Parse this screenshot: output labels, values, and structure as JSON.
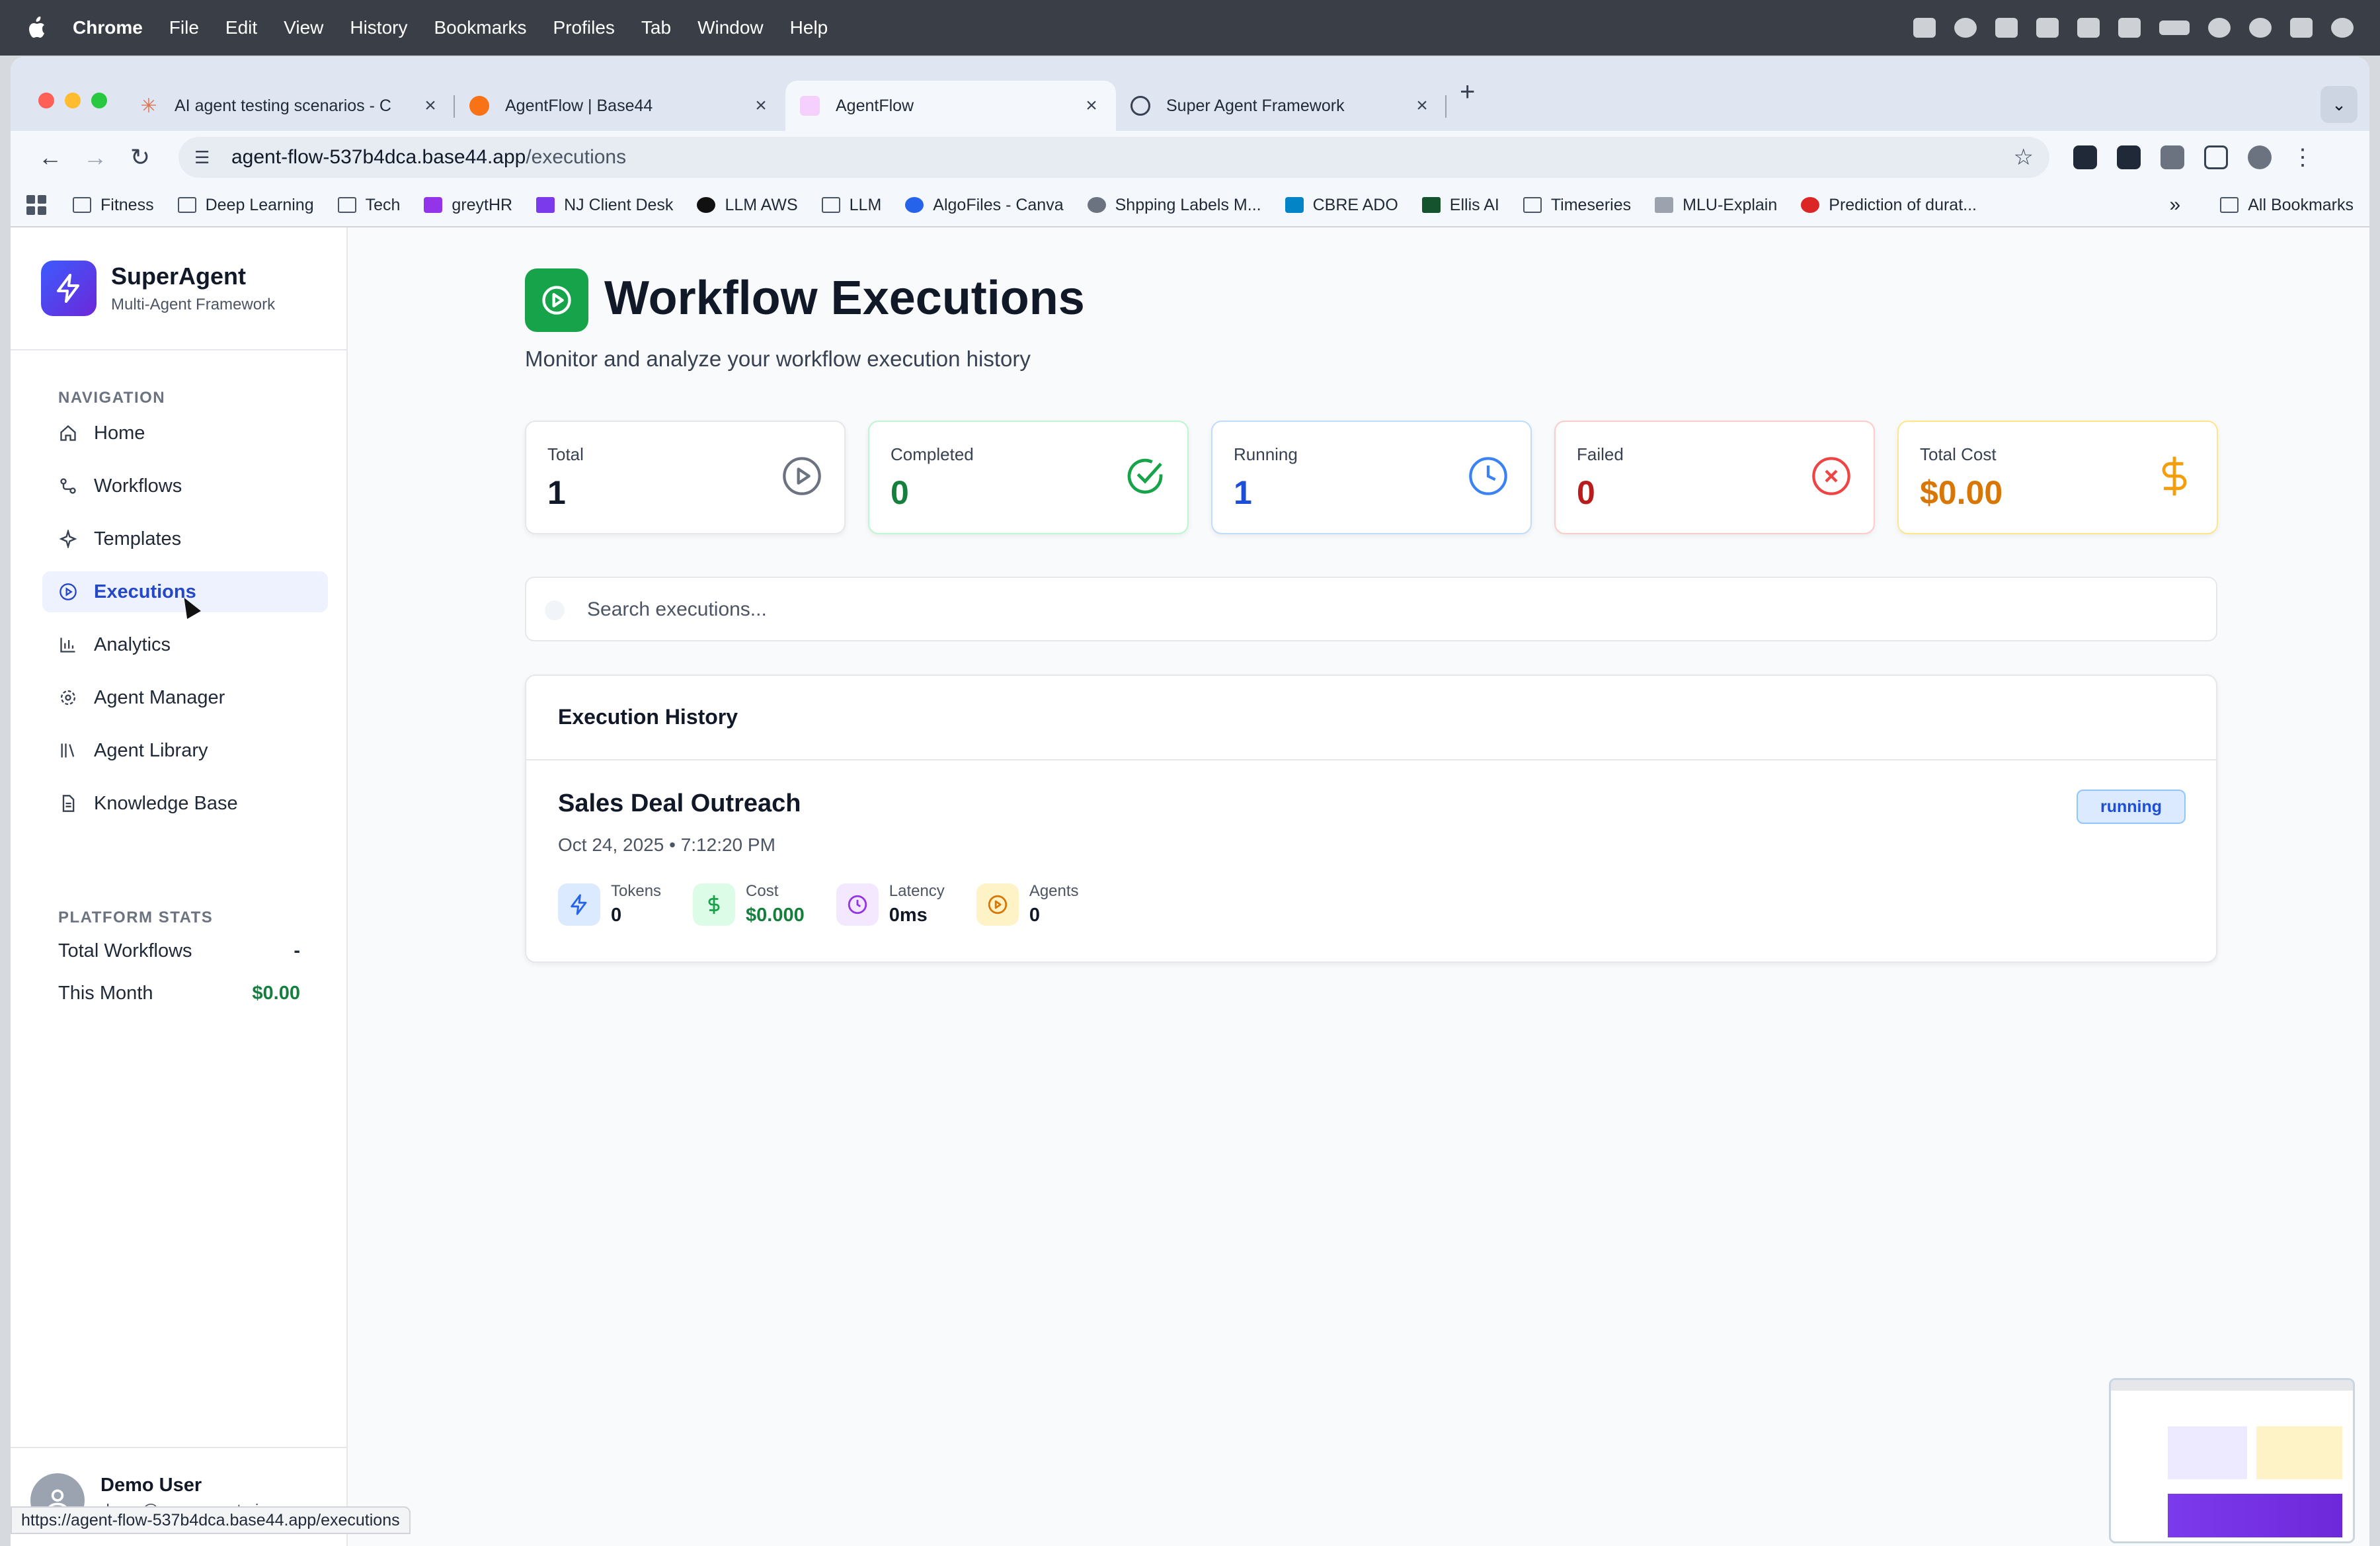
{
  "menubar": {
    "app": "Chrome",
    "items": [
      "File",
      "Edit",
      "View",
      "History",
      "Bookmarks",
      "Profiles",
      "Tab",
      "Window",
      "Help"
    ]
  },
  "browser": {
    "tabs": [
      {
        "title": "AI agent testing scenarios - C",
        "favicon": "claude-icon",
        "active": false
      },
      {
        "title": "AgentFlow | Base44",
        "favicon": "base44-icon",
        "active": false
      },
      {
        "title": "AgentFlow",
        "favicon": "agentflow-icon",
        "active": true
      },
      {
        "title": "Super Agent Framework",
        "favicon": "globe-icon",
        "active": false
      }
    ],
    "url_host": "agent-flow-537b4dca.base44.app",
    "url_path": "/executions",
    "bookmarks": [
      "Fitness",
      "Deep Learning",
      "Tech",
      "greytHR",
      "NJ Client Desk",
      "LLM AWS",
      "LLM",
      "AlgoFiles - Canva",
      "Shpping Labels M...",
      "CBRE ADO",
      "Ellis AI",
      "Timeseries",
      "MLU-Explain",
      "Prediction of durat..."
    ],
    "all_bookmarks": "All Bookmarks",
    "more_bookmarks": "»",
    "status_url": "https://agent-flow-537b4dca.base44.app/executions"
  },
  "sidebar": {
    "brand_name": "SuperAgent",
    "brand_sub": "Multi-Agent Framework",
    "nav_title": "NAVIGATION",
    "items": [
      {
        "label": "Home",
        "icon": "home-icon"
      },
      {
        "label": "Workflows",
        "icon": "workflow-icon"
      },
      {
        "label": "Templates",
        "icon": "sparkle-icon"
      },
      {
        "label": "Executions",
        "icon": "play-circle-icon",
        "active": true
      },
      {
        "label": "Analytics",
        "icon": "bar-chart-icon"
      },
      {
        "label": "Agent Manager",
        "icon": "gear-icon"
      },
      {
        "label": "Agent Library",
        "icon": "library-icon"
      },
      {
        "label": "Knowledge Base",
        "icon": "document-icon"
      }
    ],
    "stats_title": "PLATFORM STATS",
    "stats": [
      {
        "label": "Total Workflows",
        "value": "-"
      },
      {
        "label": "This Month",
        "value": "$0.00"
      }
    ],
    "user_name": "Demo User",
    "user_email": "demo@superagent.ai"
  },
  "main": {
    "title": "Workflow Executions",
    "subtitle": "Monitor and analyze your workflow execution history",
    "cards": [
      {
        "label": "Total",
        "value": "1",
        "color": "#111827",
        "icon": "play-circle-icon"
      },
      {
        "label": "Completed",
        "value": "0",
        "color": "#15803d",
        "icon": "check-circle-icon"
      },
      {
        "label": "Running",
        "value": "1",
        "color": "#1d4ed8",
        "icon": "clock-icon"
      },
      {
        "label": "Failed",
        "value": "0",
        "color": "#b91c1c",
        "icon": "x-circle-icon"
      },
      {
        "label": "Total Cost",
        "value": "$0.00",
        "color": "#d97706",
        "icon": "dollar-icon"
      }
    ],
    "search_placeholder": "Search executions...",
    "history_title": "Execution History",
    "execution": {
      "name": "Sales Deal Outreach",
      "date": "Oct 24, 2025 • 7:12:20 PM",
      "status": "running",
      "metrics": [
        {
          "label": "Tokens",
          "value": "0",
          "icon": "bolt-icon"
        },
        {
          "label": "Cost",
          "value": "$0.000",
          "icon": "dollar-icon"
        },
        {
          "label": "Latency",
          "value": "0ms",
          "icon": "clock-icon"
        },
        {
          "label": "Agents",
          "value": "0",
          "icon": "play-circle-icon"
        }
      ]
    }
  }
}
